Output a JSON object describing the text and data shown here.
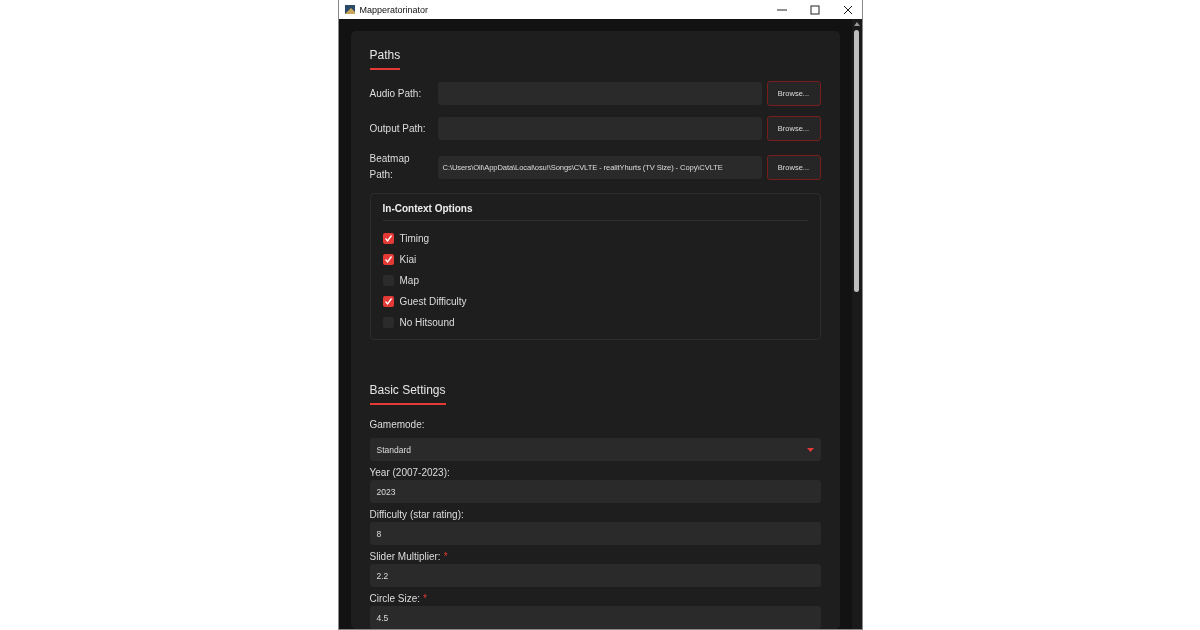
{
  "window": {
    "title": "Mapperatorinator"
  },
  "paths": {
    "title": "Paths",
    "rows": [
      {
        "label": "Audio Path:",
        "value": "",
        "button": "Browse..."
      },
      {
        "label": "Output Path:",
        "value": "",
        "button": "Browse..."
      },
      {
        "label": "Beatmap Path:",
        "value": "C:\\Users\\Oli\\AppData\\Local\\osu!\\Songs\\CVLTE - realitYhurts (TV Size) - Copy\\CVLTE",
        "button": "Browse..."
      }
    ]
  },
  "in_context": {
    "title": "In-Context Options",
    "options": [
      {
        "label": "Timing",
        "checked": true
      },
      {
        "label": "Kiai",
        "checked": true
      },
      {
        "label": "Map",
        "checked": false
      },
      {
        "label": "Guest Difficulty",
        "checked": true
      },
      {
        "label": "No Hitsound",
        "checked": false
      }
    ]
  },
  "basic": {
    "title": "Basic Settings",
    "fields": [
      {
        "kind": "select",
        "label": "Gamemode:",
        "value": "Standard"
      },
      {
        "kind": "text",
        "label": "Year (2007-2023):",
        "value": "2023"
      },
      {
        "kind": "text",
        "label": "Difficulty (star rating):",
        "value": "8"
      },
      {
        "kind": "text",
        "label": "Slider Multiplier:",
        "value": "2.2",
        "required_mark": "*"
      },
      {
        "kind": "text",
        "label": "Circle Size:",
        "value": "4.5",
        "required_mark": "*"
      }
    ]
  }
}
